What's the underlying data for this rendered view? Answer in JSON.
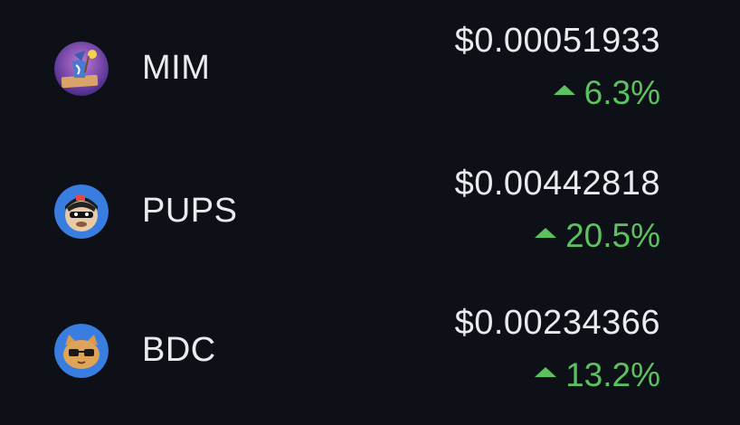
{
  "tokens": [
    {
      "symbol": "MIM",
      "price": "$0.00051933",
      "change": "6.3%",
      "direction": "up",
      "avatar_icon": "mim-wizard-avatar-icon",
      "avatar_color": "#6a3aa8"
    },
    {
      "symbol": "PUPS",
      "price": "$0.00442818",
      "change": "20.5%",
      "direction": "up",
      "avatar_icon": "pups-monkey-avatar-icon",
      "avatar_color": "#3a7de0"
    },
    {
      "symbol": "BDC",
      "price": "$0.00234366",
      "change": "13.2%",
      "direction": "up",
      "avatar_icon": "bdc-cat-avatar-icon",
      "avatar_color": "#3a7de0"
    }
  ],
  "colors": {
    "background": "#0d1016",
    "text": "#e9ebef",
    "positive": "#5cc15f"
  }
}
